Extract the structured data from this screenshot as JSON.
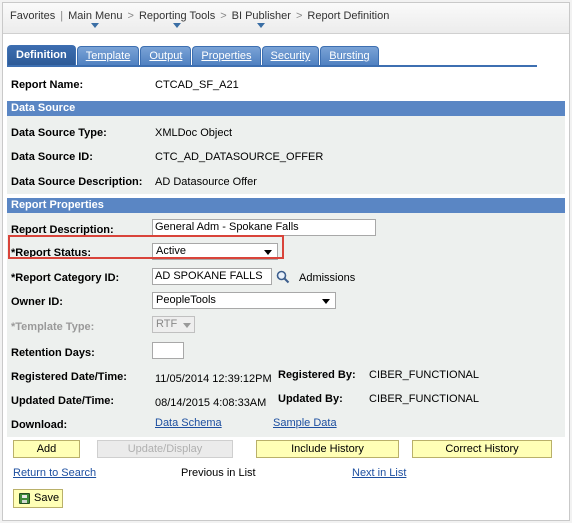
{
  "breadcrumb": {
    "items": [
      "Favorites",
      "Main Menu",
      "Reporting Tools",
      "BI Publisher",
      "Report Definition"
    ],
    "separators": [
      "|",
      ">",
      ">",
      ">"
    ]
  },
  "tabs": [
    {
      "label": "Definition",
      "active": true
    },
    {
      "label": "Template",
      "active": false
    },
    {
      "label": "Output",
      "active": false
    },
    {
      "label": "Properties",
      "active": false
    },
    {
      "label": "Security",
      "active": false
    },
    {
      "label": "Bursting",
      "active": false
    }
  ],
  "report_name": {
    "label": "Report Name:",
    "value": "CTCAD_SF_A21"
  },
  "data_source": {
    "heading": "Data Source",
    "type_label": "Data Source Type:",
    "type_value": "XMLDoc Object",
    "id_label": "Data Source ID:",
    "id_value": "CTC_AD_DATASOURCE_OFFER",
    "desc_label": "Data Source Description:",
    "desc_value": "AD Datasource Offer"
  },
  "report_properties": {
    "heading": "Report Properties",
    "description_label": "Report Description:",
    "description_value": "General Adm - Spokane Falls",
    "status_label": "*Report Status:",
    "status_value": "Active",
    "category_label": "*Report Category ID:",
    "category_value": "AD SPOKANE FALLS",
    "category_desc": "Admissions",
    "owner_label": "Owner ID:",
    "owner_value": "PeopleTools",
    "template_type_label": "*Template Type:",
    "template_type_value": "RTF",
    "retention_label": "Retention Days:",
    "retention_value": "",
    "registered_date_label": "Registered Date/Time:",
    "registered_date_value": "11/05/2014 12:39:12PM",
    "registered_by_label": "Registered By:",
    "registered_by_value": "CIBER_FUNCTIONAL",
    "updated_date_label": "Updated Date/Time:",
    "updated_date_value": "08/14/2015  4:08:33AM",
    "updated_by_label": "Updated By:",
    "updated_by_value": "CIBER_FUNCTIONAL",
    "download_label": "Download:",
    "data_schema_link": "Data Schema",
    "sample_data_link": "Sample Data"
  },
  "buttons": {
    "add": "Add",
    "update_display": "Update/Display",
    "include_history": "Include History",
    "correct_history": "Correct History"
  },
  "nav": {
    "return_to_search": "Return to Search",
    "previous_in_list": "Previous in List",
    "next_in_list": "Next in List"
  },
  "save": {
    "label": "Save"
  },
  "colors": {
    "section_header": "#5a86c4",
    "tab_active": "#2d5a96",
    "button_bg": "#ffffb6",
    "highlight": "#d9443a",
    "link": "#1d4fa0"
  }
}
